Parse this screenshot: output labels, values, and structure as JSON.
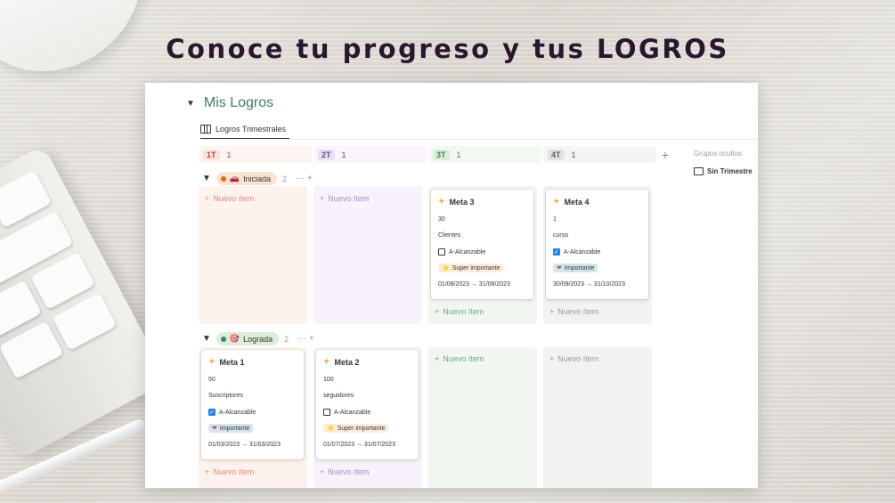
{
  "headline": "Conoce tu progreso y tus LOGROS",
  "page": {
    "title": "Mis Logros",
    "view_tab": "Logros Trimestrales"
  },
  "columns": [
    {
      "label": "1T",
      "count": "1",
      "chip_bg": "#fde2e1",
      "chip_fg": "#b8453f",
      "head_bg": "#fdf5f2",
      "lane_bg": "#fdf2ed"
    },
    {
      "label": "2T",
      "count": "1",
      "chip_bg": "#e8deee",
      "chip_fg": "#6940a5",
      "head_bg": "#f9f5fb",
      "lane_bg": "#f7f2fb"
    },
    {
      "label": "3T",
      "count": "1",
      "chip_bg": "#dbeddb",
      "chip_fg": "#448361",
      "head_bg": "#f4f8f3",
      "lane_bg": "#f1f6f0"
    },
    {
      "label": "4T",
      "count": "1",
      "chip_bg": "#e3e2e0",
      "chip_fg": "#5a5955",
      "head_bg": "#f5f5f4",
      "lane_bg": "#f2f2f1"
    }
  ],
  "add_column_icon": "+",
  "hidden_groups": {
    "title": "Grupos ocultos",
    "item": "Sin Trimestre"
  },
  "groups": [
    {
      "label": "Iniciada",
      "emoji": "🚗",
      "count": "2",
      "pill_bg": "#fbe4d4",
      "dot": "#d9730d",
      "tools": "··· +"
    },
    {
      "label": "Lograda",
      "emoji": "🎯",
      "count": "2",
      "pill_bg": "#dbeddb",
      "dot": "#448361",
      "tools": "··· +"
    }
  ],
  "new_item_label": "Nuevo ítem",
  "cards": {
    "meta3": {
      "title": "Meta 3",
      "number": "30",
      "unit": "Clientes",
      "check_label": "A-Alcanzable",
      "checked": false,
      "tag": "Super importante",
      "tag_icon": "⭐",
      "dates": "01/08/2023 → 31/08/2023"
    },
    "meta4": {
      "title": "Meta 4",
      "number": "1",
      "unit": "curso",
      "check_label": "A-Alcanzable",
      "checked": true,
      "tag": "Importante",
      "tag_icon": "❤",
      "dates": "30/09/2023 → 31/10/2023"
    },
    "meta1": {
      "title": "Meta 1",
      "number": "50",
      "unit": "Suscriptores",
      "check_label": "A-Alcanzable",
      "checked": true,
      "tag": "Importante",
      "tag_icon": "❤",
      "dates": "01/03/2023 → 31/03/2023"
    },
    "meta2": {
      "title": "Meta 2",
      "number": "100",
      "unit": "seguidores",
      "check_label": "A-Alcanzable",
      "checked": false,
      "tag": "Super importante",
      "tag_icon": "⭐",
      "dates": "01/07/2023 → 31/07/2023"
    }
  }
}
